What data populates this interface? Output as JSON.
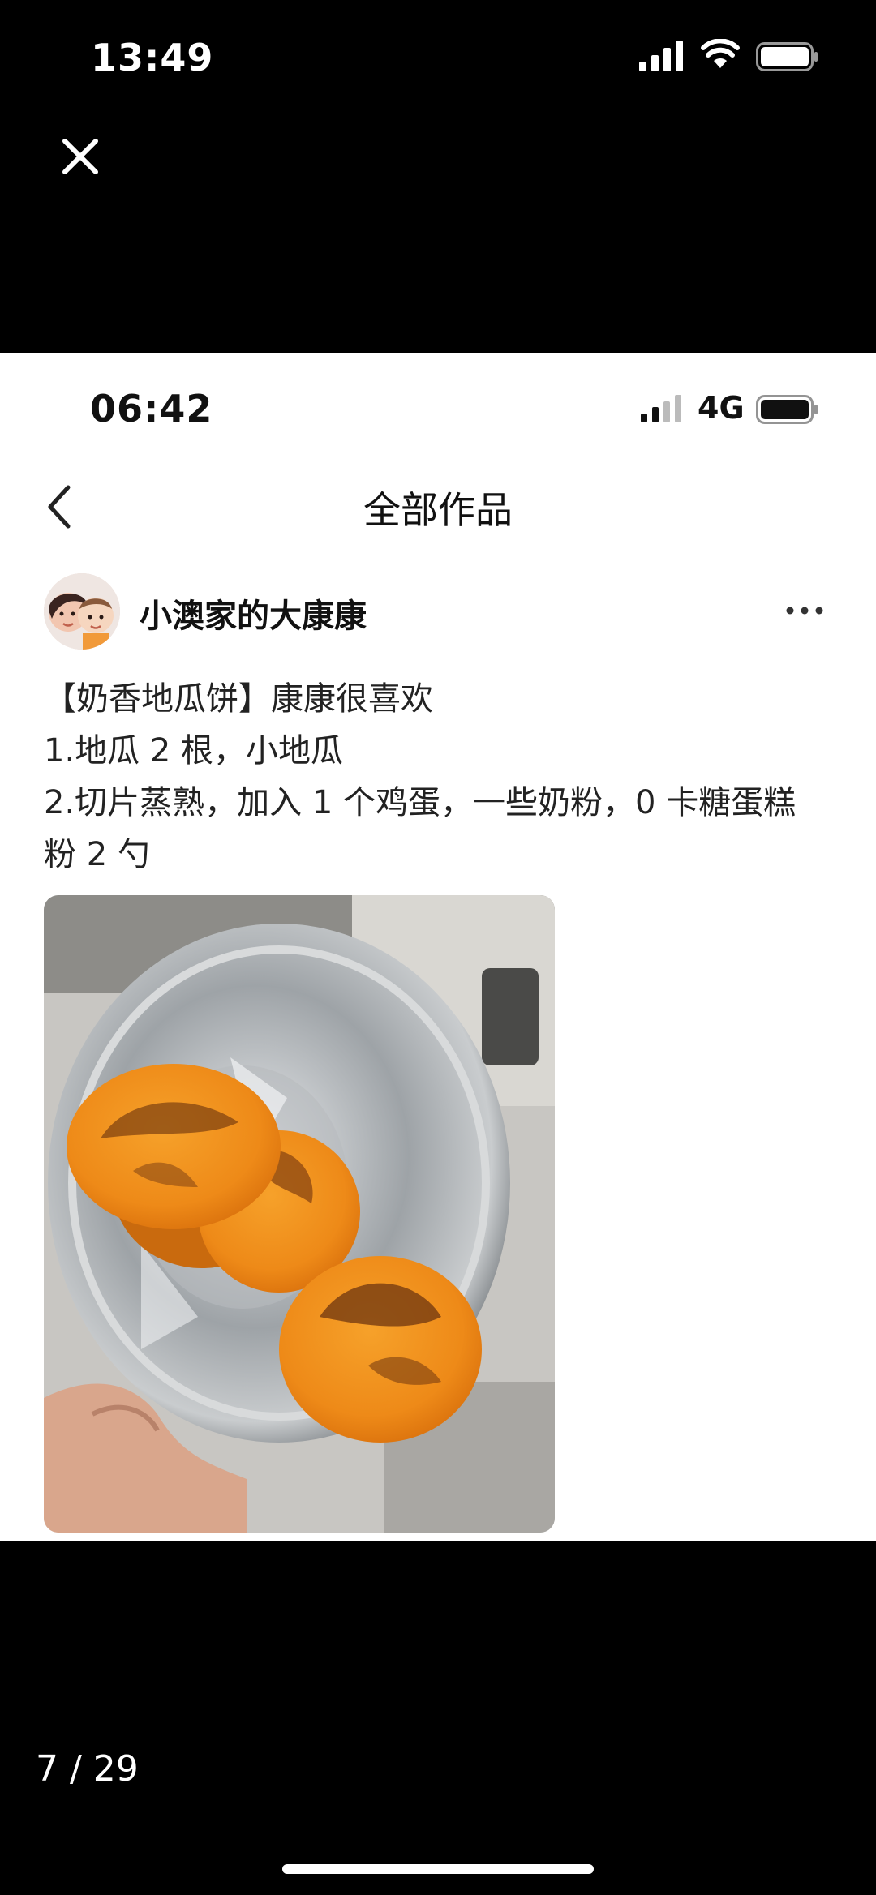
{
  "viewer": {
    "status_time": "13:49",
    "page_indicator": "7 / 29",
    "icons": {
      "signal": "signal-bars-icon",
      "wifi": "wifi-icon",
      "battery": "battery-icon",
      "close": "close-icon"
    }
  },
  "screenshot": {
    "status_time": "06:42",
    "network": "4G",
    "header": {
      "title": "全部作品",
      "back_icon": "chevron-left-icon"
    },
    "post": {
      "author": "小澳家的大康康",
      "more_icon": "more-dots-icon",
      "lines": [
        "【奶香地瓜饼】康康很喜欢",
        "1.地瓜 2 根，小地瓜",
        "2.切片蒸熟，加入 1 个鸡蛋，一些奶粉，0 卡糖蛋糕",
        "粉 2 勺"
      ],
      "photo": "sweet-potato-pancakes-photo"
    }
  },
  "colors": {
    "background": "#000000",
    "card": "#ffffff",
    "text": "#222222",
    "pancake": "#f08a1c"
  }
}
